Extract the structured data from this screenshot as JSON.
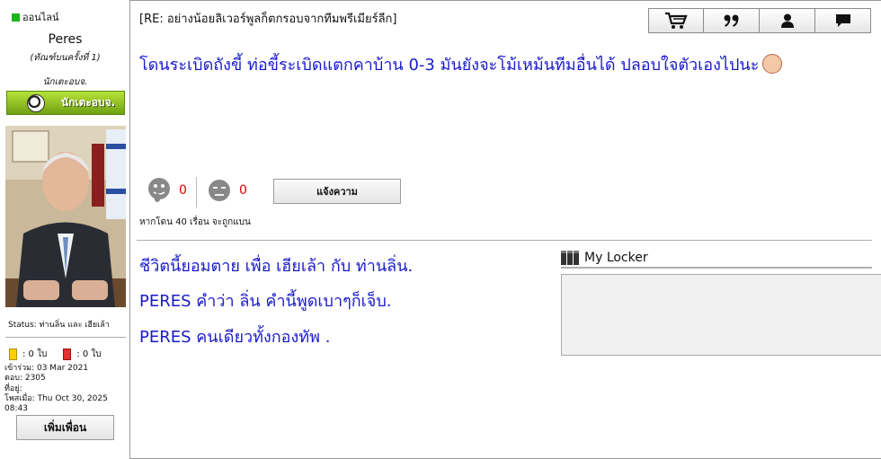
{
  "user": {
    "online_label": "ออนไลน์",
    "name": "Peres",
    "rank": "(ทัณฑ์บนครั้งที่ 1)",
    "title": "นักเตะอบจ.",
    "badge_label": "นักเตะอบจ.",
    "status_label": "Status:",
    "status_text": "ท่านลิ่น และ เฮียเล้า",
    "yellow_cards": ": 0 ใบ",
    "red_cards": ": 0 ใบ",
    "joined": "เข้าร่วม: 03 Mar 2021",
    "posts": "ตอบ: 2305",
    "location": "ที่อยู่:",
    "last_post": "โพสเมื่อ: Thu Oct 30, 2025 08:43",
    "add_friend_label": "เพิ่มเพื่อน"
  },
  "post": {
    "topic": "[RE: อย่างน้อยลิเวอร์พูลก็ตกรอบจากทีมพรีเมียร์ลีก]",
    "body": "โดนระเบิดถังขี้ ท่อขี้ระเบิดแตกคาบ้าน 0-3 มันยังจะโม้เหม้นทีมอื่นได้ ปลอบใจตัวเองไปนะ",
    "like_count": "0",
    "dislike_count": "0",
    "report_label": "แจ้งความ",
    "banned_note": "หากโดน 40 เรื่อน จะถูกแบน"
  },
  "toolbar": {
    "icons": [
      "cart-icon",
      "quote-icon",
      "profile-icon",
      "message-icon"
    ]
  },
  "signature": {
    "lines": [
      "ชีวิตนี้ยอมตาย เพื่อ เฮียเล้า กับ ท่านลิ่น.",
      "PERES คำว่า ลิ่น คำนี้พูดเบาๆก็เจ็บ.",
      "PERES คนเดียวทั้งกองทัพ ."
    ]
  },
  "locker": {
    "title": "My Locker"
  },
  "colors": {
    "post_text": "#1a1acc",
    "count": "#e00000",
    "online": "#1bb51b",
    "badge": "#8cc21f"
  }
}
